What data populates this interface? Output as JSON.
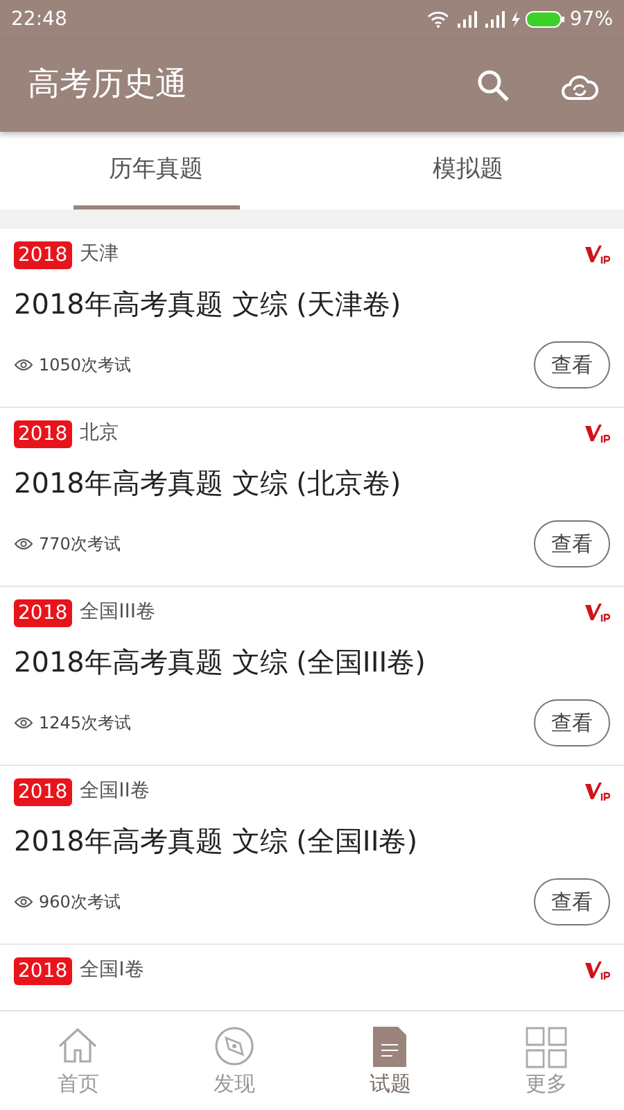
{
  "status_bar": {
    "time": "22:48",
    "battery": "97%"
  },
  "app_bar": {
    "title": "高考历史通"
  },
  "tabs": [
    {
      "label": "历年真题",
      "selected": true
    },
    {
      "label": "模拟题",
      "selected": false
    }
  ],
  "exams": [
    {
      "year": "2018",
      "region": "天津",
      "vip": true,
      "title": "2018年高考真题 文综 (天津卷)",
      "views": "1050次考试",
      "action": "查看"
    },
    {
      "year": "2018",
      "region": "北京",
      "vip": true,
      "title": "2018年高考真题 文综 (北京卷)",
      "views": "770次考试",
      "action": "查看"
    },
    {
      "year": "2018",
      "region": "全国III卷",
      "vip": true,
      "title": "2018年高考真题 文综 (全国III卷)",
      "views": "1245次考试",
      "action": "查看"
    },
    {
      "year": "2018",
      "region": "全国II卷",
      "vip": true,
      "title": "2018年高考真题 文综 (全国II卷)",
      "views": "960次考试",
      "action": "查看"
    },
    {
      "year": "2018",
      "region": "全国I卷",
      "vip": true
    }
  ],
  "bottom_nav": [
    {
      "label": "首页",
      "selected": false
    },
    {
      "label": "发现",
      "selected": false
    },
    {
      "label": "试题",
      "selected": true
    },
    {
      "label": "更多",
      "selected": false
    }
  ]
}
